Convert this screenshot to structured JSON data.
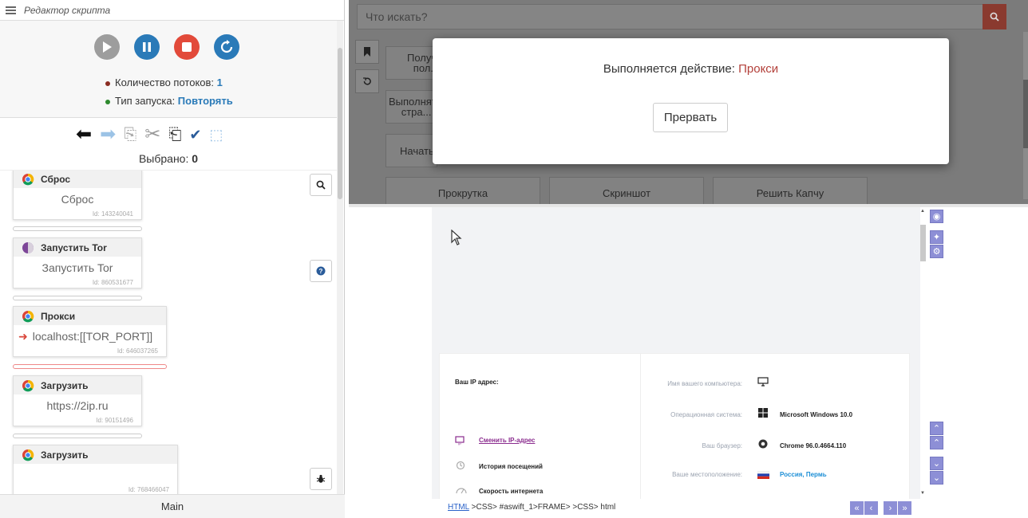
{
  "left_panel": {
    "title": "Редактор скрипта",
    "threads_label": "Количество потоков: ",
    "threads_value": "1",
    "launch_label": "Тип запуска: ",
    "launch_value": "Повторять",
    "selected_label": "Выбрано: ",
    "selected_value": "0",
    "nodes": [
      {
        "title": "Сброс",
        "body": "Сброс",
        "id": "Id: 143240041"
      },
      {
        "title": "Запустить Tor",
        "body": "Запустить Tor",
        "id": "Id: 860531677"
      },
      {
        "title": "Прокси",
        "body": "localhost:[[TOR_PORT]]",
        "id": "Id: 646037265"
      },
      {
        "title": "Загрузить",
        "body": "https://2ip.ru",
        "id": "Id: 90151496"
      },
      {
        "title": "Загрузить",
        "body": "",
        "id": "Id: 768466047"
      }
    ],
    "footer": "Main"
  },
  "top_area": {
    "search_placeholder": "Что искать?",
    "buttons": [
      "Получ... пол...",
      "Выполнят... стра...",
      "Начать",
      "Прокрутка",
      "Скриншот",
      "Решить Капчу"
    ]
  },
  "modal": {
    "message_prefix": "Выполняется действие: ",
    "message_action": "Прокси",
    "stop_label": "Прервать"
  },
  "browser": {
    "ip_label": "Ваш IP адрес:",
    "change_ip": "Сменить IP-адрес",
    "history": "История посещений",
    "speed": "Скорость интернета",
    "computer_name_label": "Имя вашего компьютера:",
    "os_label": "Операционная система:",
    "os_value": "Microsoft Windows 10.0",
    "browser_label": "Ваш браузер:",
    "browser_value": "Chrome 96.0.4664.110",
    "location_label": "Ваше местоположение:",
    "location_value": "Россия, Пермь"
  },
  "path_bar": {
    "html_link": "HTML",
    "rest": " >CSS> #aswift_1>FRAME> >CSS> html"
  },
  "colors": {
    "accent": "#2a7ab8",
    "danger": "#e24a3a",
    "modal_action": "#b3403a",
    "tools": "#8d8fd6"
  }
}
